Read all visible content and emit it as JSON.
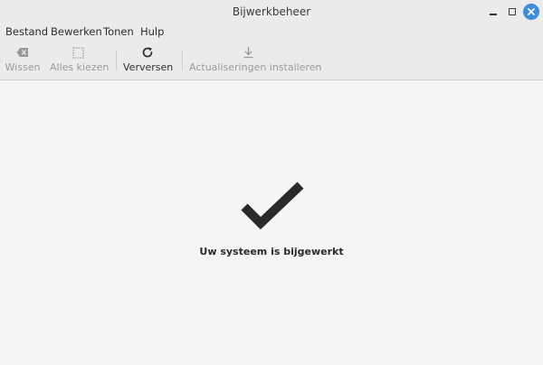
{
  "window": {
    "title": "Bijwerkbeheer"
  },
  "menu": {
    "items": [
      {
        "label": "Bestand"
      },
      {
        "label": "Bewerken"
      },
      {
        "label": "Tonen"
      },
      {
        "label": "Hulp"
      }
    ]
  },
  "toolbar": {
    "clear_label": "Wissen",
    "select_all_label": "Alles kiezen",
    "refresh_label": "Verversen",
    "install_label": "Actualiseringen installeren"
  },
  "main": {
    "status_text": "Uw systeem is bijgewerkt",
    "status_icon": "checkmark-icon"
  },
  "colors": {
    "close_button": "#3a8fd8",
    "checkmark": "#2a2a2a",
    "disabled_text": "#9a9a9a"
  }
}
